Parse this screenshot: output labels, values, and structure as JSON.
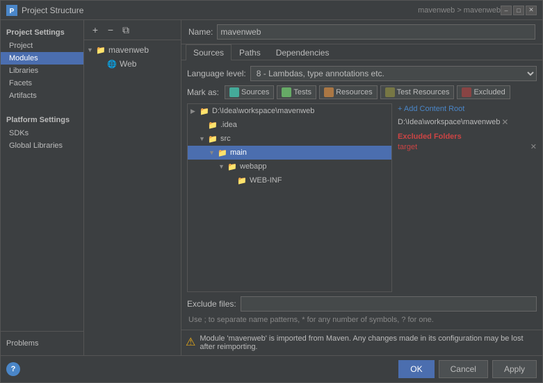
{
  "window": {
    "title": "Project Structure",
    "icon": "P"
  },
  "left_panel": {
    "project_settings_header": "Project Settings",
    "nav_items": [
      {
        "id": "project",
        "label": "Project"
      },
      {
        "id": "modules",
        "label": "Modules",
        "active": true
      },
      {
        "id": "libraries",
        "label": "Libraries"
      },
      {
        "id": "facets",
        "label": "Facets"
      },
      {
        "id": "artifacts",
        "label": "Artifacts"
      }
    ],
    "platform_header": "Platform Settings",
    "platform_items": [
      {
        "id": "sdks",
        "label": "SDKs"
      },
      {
        "id": "global-libraries",
        "label": "Global Libraries"
      }
    ],
    "problems": "Problems"
  },
  "center_panel": {
    "toolbar": {
      "add_label": "+",
      "remove_label": "−",
      "copy_label": "⧉"
    },
    "tree": {
      "module_name": "mavenweb",
      "children": [
        {
          "label": "Web",
          "type": "web",
          "indent": 1
        }
      ]
    }
  },
  "right_panel": {
    "name_label": "Name:",
    "name_value": "mavenweb",
    "tabs": [
      {
        "id": "sources",
        "label": "Sources",
        "active": true
      },
      {
        "id": "paths",
        "label": "Paths"
      },
      {
        "id": "dependencies",
        "label": "Dependencies"
      }
    ],
    "language_label": "Language level:",
    "language_value": "8 - Lambdas, type annotations etc.",
    "mark_as_label": "Mark as:",
    "mark_buttons": [
      {
        "id": "sources",
        "label": "Sources",
        "color": "#4a9"
      },
      {
        "id": "tests",
        "label": "Tests",
        "color": "#6a6"
      },
      {
        "id": "resources",
        "label": "Resources",
        "color": "#a74"
      },
      {
        "id": "test-resources",
        "label": "Test Resources",
        "color": "#774"
      },
      {
        "id": "excluded",
        "label": "Excluded",
        "color": "#844"
      }
    ],
    "file_tree": [
      {
        "label": "D:\\Idea\\workspace\\mavenweb",
        "indent": 0,
        "arrow": "▶",
        "type": "folder"
      },
      {
        "label": ".idea",
        "indent": 1,
        "arrow": "",
        "type": "folder"
      },
      {
        "label": "src",
        "indent": 1,
        "arrow": "▼",
        "type": "folder"
      },
      {
        "label": "main",
        "indent": 2,
        "arrow": "▼",
        "type": "folder",
        "highlighted": true
      },
      {
        "label": "webapp",
        "indent": 3,
        "arrow": "▼",
        "type": "folder"
      },
      {
        "label": "WEB-INF",
        "indent": 4,
        "arrow": "",
        "type": "folder"
      }
    ],
    "content_root": {
      "add_label": "+ Add Content Root",
      "root_path": "D:\\Idea\\workspace\\mavenweb",
      "excluded_title": "Excluded Folders",
      "excluded_item": "target"
    },
    "exclude_files_label": "Exclude files:",
    "exclude_files_value": "",
    "exclude_hint": "Use ; to separate name patterns, * for any number of symbols, ? for one.",
    "warning_text": "Module 'mavenweb' is imported from Maven. Any changes made in its configuration may be lost after reimporting.",
    "buttons": {
      "ok": "OK",
      "cancel": "Cancel",
      "apply": "Apply"
    }
  }
}
